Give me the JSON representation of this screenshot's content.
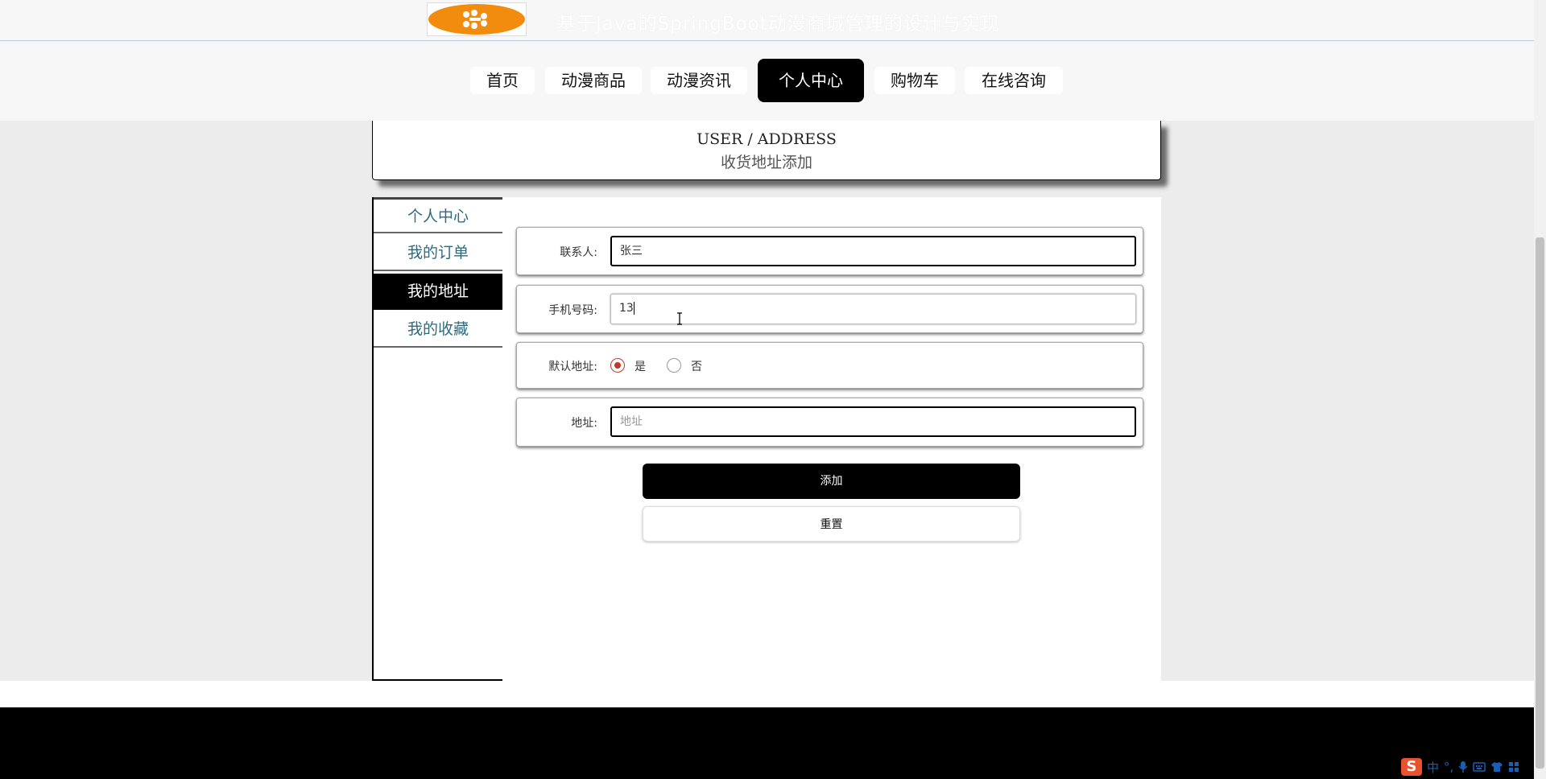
{
  "site": {
    "title": "基于Java的SpringBoot动漫商城管理的设计与实现"
  },
  "nav": {
    "items": [
      {
        "label": "首页"
      },
      {
        "label": "动漫商品"
      },
      {
        "label": "动漫资讯"
      },
      {
        "label": "个人中心"
      },
      {
        "label": "购物车"
      },
      {
        "label": "在线咨询"
      }
    ],
    "active_index": 3
  },
  "header": {
    "en": "USER / ADDRESS",
    "cn": "收货地址添加"
  },
  "sidebar": {
    "items": [
      {
        "label": "个人中心"
      },
      {
        "label": "我的订单"
      },
      {
        "label": "我的地址"
      },
      {
        "label": "我的收藏"
      }
    ],
    "active_index": 2
  },
  "form": {
    "contact_label": "联系人:",
    "contact_value": "张三",
    "phone_label": "手机号码:",
    "phone_value": "13",
    "default_label": "默认地址:",
    "default_yes": "是",
    "default_no": "否",
    "default_selected": "是",
    "address_label": "地址:",
    "address_placeholder": "地址",
    "add_button": "添加",
    "reset_button": "重置"
  },
  "ime": {
    "logo": "S",
    "mode": "中"
  },
  "colors": {
    "accent": "#000000",
    "sidebar_link": "#2e6a7e",
    "radio_checked": "#c0392b",
    "logo_orange": "#f28c0f"
  }
}
